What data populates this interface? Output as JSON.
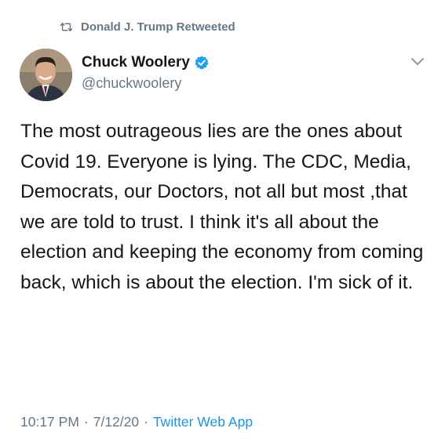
{
  "retweet": {
    "label": "Donald J. Trump Retweeted",
    "icon": "retweet-icon"
  },
  "author": {
    "display_name": "Chuck Woolery",
    "handle": "@chuckwoolery",
    "verified": true,
    "avatar_icon": "avatar"
  },
  "tweet": {
    "text": "The most outrageous lies are the ones about Covid 19. Everyone is lying. The CDC, Media, Democrats, our Doctors, not all but most ,that we are told to trust. I think it's all about the election and keeping the economy from coming back, which is about the election. I'm sick of it."
  },
  "meta": {
    "time": "10:17 PM",
    "date": "7/12/20",
    "separator": "·",
    "source": "Twitter Web App"
  },
  "colors": {
    "secondary_text": "#657786",
    "link": "#1b95e0",
    "verified": "#1da1f2",
    "text": "#14171a"
  }
}
